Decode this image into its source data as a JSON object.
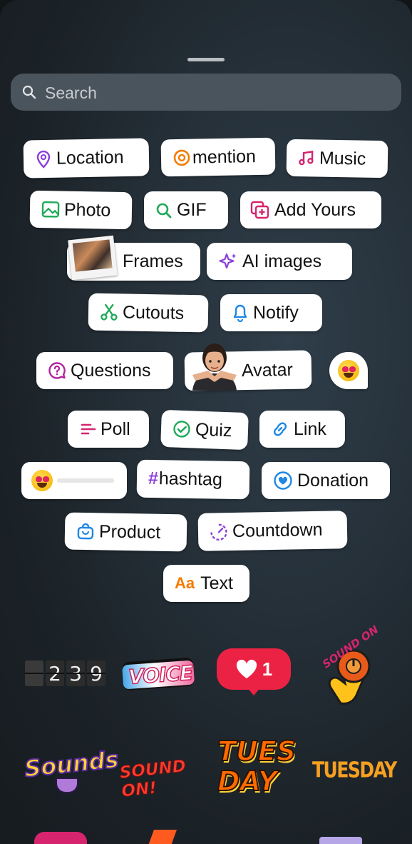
{
  "search": {
    "placeholder": "Search"
  },
  "stickers": {
    "location": "Location",
    "mention": "mention",
    "music": "Music",
    "photo": "Photo",
    "gif": "GIF",
    "add_yours": "Add Yours",
    "frames": "Frames",
    "ai_images": "AI images",
    "cutouts": "Cutouts",
    "notify": "Notify",
    "questions": "Questions",
    "avatar": "Avatar",
    "poll": "Poll",
    "quiz": "Quiz",
    "link": "Link",
    "hashtag": "hashtag",
    "donation": "Donation",
    "product": "Product",
    "countdown": "Countdown",
    "text": "Text"
  },
  "glyphs": {
    "hash": "#",
    "text_icon": "Aa"
  },
  "gallery": {
    "clock_digits": [
      "2",
      "3",
      "9"
    ],
    "voice": "VOICE",
    "like_count": "1",
    "sound_on": "SOUND ON",
    "sounds": "Sounds",
    "sound_on_2": "SOUND ON!",
    "tues_day": "TUES DAY",
    "tuesday": "TUESDAY"
  },
  "colors": {
    "pill_bg": "#ffffff",
    "like_red": "#ec2244",
    "search_bg": "#4a545c",
    "location": "#8b3fd9",
    "mention": "#f57c00",
    "music": "#d6246e",
    "photo": "#1faa59",
    "gif": "#1faa59",
    "add_yours": "#d6246e",
    "ai_images": "#8b3fd9",
    "cutouts": "#1faa59",
    "notify": "#1e88e5",
    "questions": "#b0259e",
    "poll": "#d6246e",
    "quiz": "#1faa59",
    "link": "#1e88e5",
    "hashtag": "#8b3fd9",
    "donation": "#1e88e5",
    "product": "#1e88e5",
    "countdown": "#8b3fd9",
    "text": "#f57c00"
  }
}
